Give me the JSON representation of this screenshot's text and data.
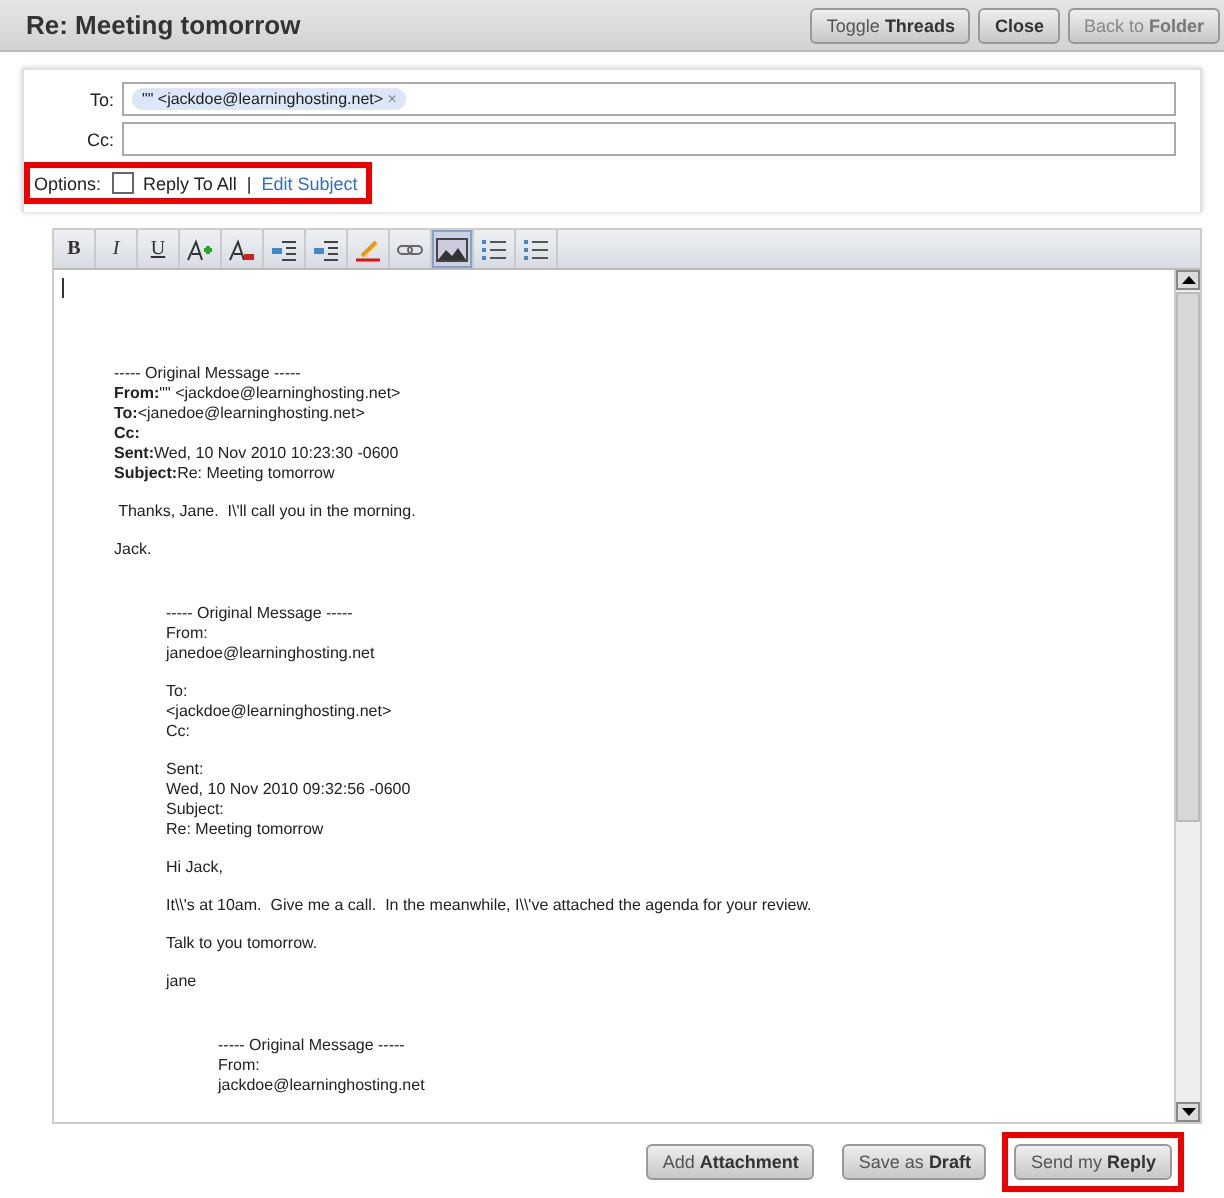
{
  "window": {
    "title": "Re: Meeting tomorrow"
  },
  "header_buttons": [
    {
      "plain": "Toggle",
      "bold": "Threads",
      "disabled": false
    },
    {
      "bold": "Close",
      "disabled": false
    },
    {
      "plain": "Back to",
      "bold": "Folder",
      "disabled": true
    }
  ],
  "to": {
    "label": "To:",
    "recipients": [
      {
        "text": "\"\" <jackdoe@learninghosting.net>",
        "remove": "×"
      }
    ]
  },
  "cc": {
    "label": "Cc:"
  },
  "options": {
    "label": "Options:",
    "reply_all": {
      "label": "Reply To All",
      "checked": false
    },
    "separator": "|",
    "edit_subject": "Edit Subject",
    "highlighted": true
  },
  "toolbar": [
    {
      "kind": "bold",
      "label": "B",
      "selected": false
    },
    {
      "kind": "italic",
      "label": "I",
      "selected": false
    },
    {
      "kind": "underline",
      "label": "U",
      "selected": false
    },
    {
      "kind": "font-color",
      "selected": false
    },
    {
      "kind": "remove-color",
      "selected": false
    },
    {
      "kind": "indent",
      "selected": false
    },
    {
      "kind": "outdent",
      "selected": false
    },
    {
      "kind": "highlight",
      "selected": false
    },
    {
      "kind": "link",
      "selected": false
    },
    {
      "kind": "image",
      "selected": true
    },
    {
      "kind": "numbered-list",
      "selected": false
    },
    {
      "kind": "bullet-list",
      "selected": false
    }
  ],
  "body": {
    "paragraphs": [
      [
        "----- Original Message -----",
        "**From:**\"\" <jackdoe@learninghosting.net>",
        "**To:**<janedoe@learninghosting.net>",
        "**Cc:**",
        "**Sent:**Wed, 10 Nov 2010 10:23:30 -0600",
        "**Subject:**Re: Meeting tomorrow"
      ],
      [
        " Thanks, Jane.  I\\'ll call you in the morning."
      ],
      [
        "Jack."
      ]
    ],
    "quote": {
      "paragraphs": [
        [
          "----- Original Message -----",
          "From:",
          "janedoe@learninghosting.net"
        ],
        [
          "To:",
          "<jackdoe@learninghosting.net>",
          "Cc:"
        ],
        [
          "Sent:",
          "Wed, 10 Nov 2010 09:32:56 -0600",
          "Subject:",
          "Re: Meeting tomorrow"
        ],
        [
          "Hi Jack,"
        ],
        [
          "It\\\\'s at 10am.  Give me a call.  In the meanwhile, I\\\\'ve attached the agenda for your review."
        ],
        [
          "Talk to you tomorrow."
        ],
        [
          "jane"
        ]
      ],
      "quote": {
        "paragraphs": [
          [
            "----- Original Message -----",
            "From:",
            "jackdoe@learninghosting.net"
          ]
        ]
      }
    }
  },
  "footer_buttons": [
    {
      "plain": "Add",
      "bold": "Attachment",
      "highlighted": false
    },
    {
      "plain": "Save as",
      "bold": "Draft",
      "highlighted": false
    },
    {
      "plain": "Send my",
      "bold": "Reply",
      "highlighted": true
    }
  ]
}
